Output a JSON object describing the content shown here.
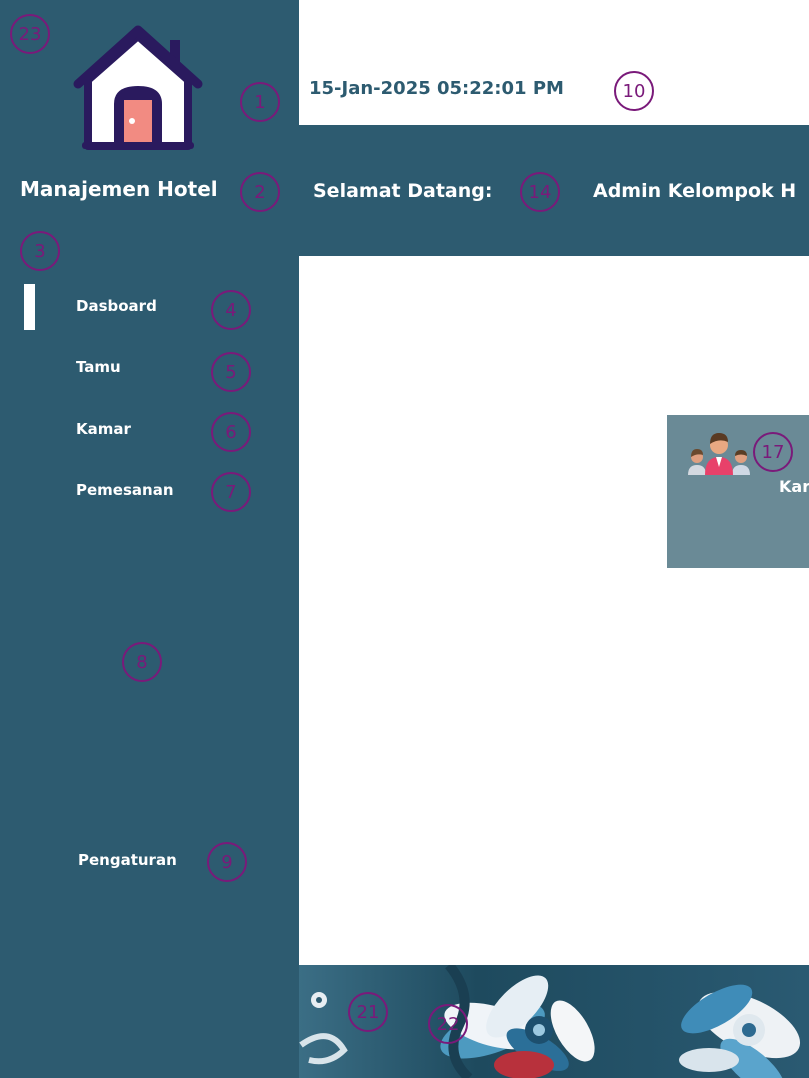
{
  "app": {
    "title": "Manajemen Hotel",
    "logo_icon": "house-icon"
  },
  "header": {
    "datetime": "15-Jan-2025 05:22:01 PM",
    "welcome_label": "Selamat Datang:",
    "user_name": "Admin Kelompok H"
  },
  "sidebar": {
    "items": [
      {
        "label": "Dasboard",
        "active": true
      },
      {
        "label": "Tamu",
        "active": false
      },
      {
        "label": "Kamar",
        "active": false
      },
      {
        "label": "Pemesanan",
        "active": false
      }
    ],
    "settings_label": "Pengaturan"
  },
  "main": {
    "card": {
      "icon": "people-icon",
      "label": "Kar"
    }
  },
  "footer": {
    "image": "floral-batik-pattern"
  },
  "annotations": [
    "1",
    "2",
    "3",
    "4",
    "5",
    "6",
    "7",
    "8",
    "9",
    "10",
    "14",
    "17",
    "21",
    "22",
    "23"
  ],
  "colors": {
    "primary": "#2d5b70",
    "card": "#6a8a96",
    "marker": "#7a1a7a",
    "house_roof": "#2a1a5e",
    "house_door": "#f28b82"
  }
}
